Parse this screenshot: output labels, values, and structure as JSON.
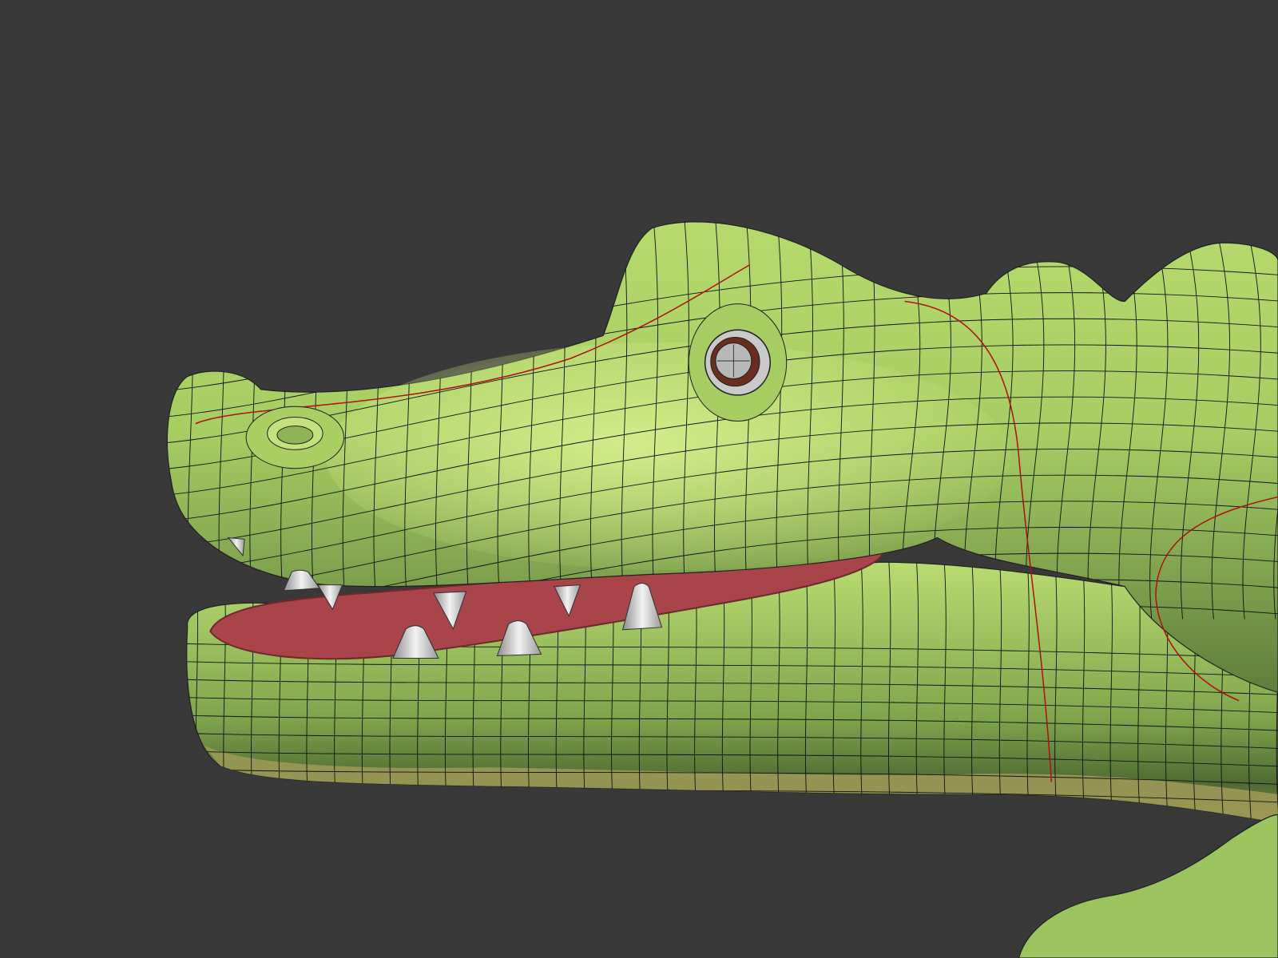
{
  "scene": {
    "subject": "crocodile-head-wireframe-model",
    "colors": {
      "background": "#393939",
      "skin_light": "#c6e47c",
      "skin_mid": "#93bd5a",
      "skin_dark": "#54733a",
      "belly": "#a09a58",
      "mouth": "#a8444a",
      "mouth_dark": "#6e2a2e",
      "teeth": "#d9d9d9",
      "wire": "#111111",
      "seam": "#b01010",
      "eye_ring": "#c9c9c9",
      "iris": "#6a2e1e"
    }
  }
}
